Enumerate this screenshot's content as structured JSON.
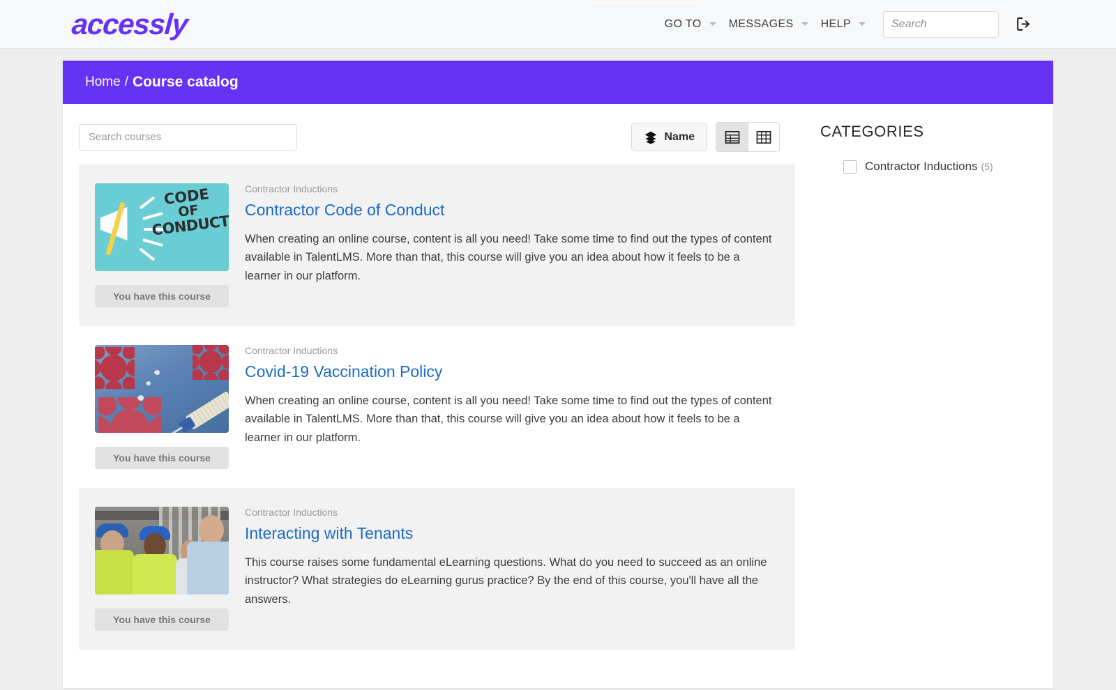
{
  "topbar": {
    "logo": "accessly",
    "nav": [
      {
        "label": "GO TO",
        "has_caret": true
      },
      {
        "label": "MESSAGES",
        "has_caret": true
      },
      {
        "label": "HELP",
        "has_caret": true
      }
    ],
    "search_placeholder": "Search",
    "search_value": "",
    "logout_icon": "logout-icon"
  },
  "breadcrumb": {
    "home": "Home",
    "separator": "/",
    "current": "Course catalog",
    "bar_color": "#6633f5"
  },
  "toolbar": {
    "search_placeholder": "Search courses",
    "search_value": "",
    "sort_label": "Name",
    "sort_icon": "layers-icon",
    "views": [
      {
        "name": "list-view",
        "icon": "table-rows-icon",
        "active": true
      },
      {
        "name": "grid-view",
        "icon": "grid-icon",
        "active": false
      }
    ]
  },
  "courses": [
    {
      "category": "Contractor Inductions",
      "title": "Contractor Code of Conduct",
      "description": "When creating an online course, content is all you need! Take some time to find out the types of content available in TalentLMS. More than that, this course will give you an idea about how it feels to be a learner in our platform.",
      "action_label": "You have this course",
      "thumbnail": "code-of-conduct-megaphone-image",
      "thumb_text_1": "CODE",
      "thumb_text_2": "OF",
      "thumb_text_3": "CONDUCT"
    },
    {
      "category": "Contractor Inductions",
      "title": "Covid-19 Vaccination Policy",
      "description": "When creating an online course, content is all you need! Take some time to find out the types of content available in TalentLMS. More than that, this course will give you an idea about how it feels to be a learner in our platform.",
      "action_label": "You have this course",
      "thumbnail": "covid-virus-syringe-image"
    },
    {
      "category": "Contractor Inductions",
      "title": "Interacting with Tenants",
      "description": "This course raises some fundamental eLearning questions. What do you need to succeed as an online instructor? What strategies do eLearning gurus practice? By the end of this course, you'll have all the answers.",
      "action_label": "You have this course",
      "thumbnail": "construction-workers-handshake-image"
    }
  ],
  "sidebar": {
    "title": "CATEGORIES",
    "categories": [
      {
        "label": "Contractor Inductions",
        "count": "(5)",
        "checked": false
      }
    ]
  },
  "colors": {
    "brand_purple": "#6633f5",
    "link_blue": "#1b6cc4",
    "row_alt": "#f2f2f2"
  }
}
